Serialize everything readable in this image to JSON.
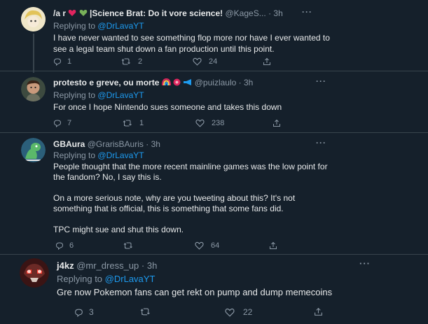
{
  "tweets": [
    {
      "name": "/a r",
      "display_suffix": "|Science Brat: Do it vore science!",
      "handle": "@KageS...",
      "time": "3h",
      "replying_label": "Replying to",
      "replying_to": "@DrLavaYT",
      "lines": [
        "I have never wanted to see something flop more nor have I ever wanted to",
        "see a legal team shut down a fan production until this point."
      ],
      "replies": "1",
      "retweets": "2",
      "likes": "24"
    },
    {
      "name": "protesto e greve, ou morte",
      "handle": "@puizlaulo",
      "time": "3h",
      "replying_label": "Replying to",
      "replying_to": "@DrLavaYT",
      "lines": [
        "For once I hope Nintendo sues someone and takes this down"
      ],
      "replies": "7",
      "retweets": "1",
      "likes": "238"
    },
    {
      "name": "GBAura",
      "handle": "@GrarisBAuris",
      "time": "3h",
      "replying_label": "Replying to",
      "replying_to": "@DrLavaYT",
      "lines": [
        "People thought that the more recent mainline games was the low point for",
        "the fandom? No, I say this is.",
        "",
        "On a more serious note, why are you tweeting about this? It's not",
        "something that is official, this is something that some fans did.",
        "",
        "TPC might sue and shut this down."
      ],
      "replies": "6",
      "retweets": "",
      "likes": "64"
    },
    {
      "name": "j4kz",
      "handle": "@mr_dress_up",
      "time": "3h",
      "replying_label": "Replying to",
      "replying_to": "@DrLavaYT",
      "lines": [
        "Gre now Pokemon fans can get rekt on pump and dump memecoins"
      ],
      "replies": "3",
      "retweets": "",
      "likes": "22"
    }
  ],
  "separator": "·",
  "more_glyph": "···",
  "colors": {
    "background": "#15202b",
    "text": "#e7e9ea",
    "muted": "#8b98a5",
    "link": "#1d9bf0",
    "divider": "#38444d"
  }
}
